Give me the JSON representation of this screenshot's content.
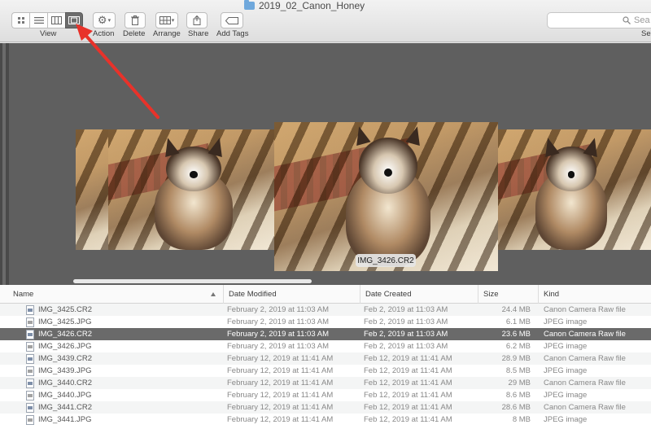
{
  "window": {
    "title": "2019_02_Canon_Honey",
    "folder_icon": "folder-icon"
  },
  "toolbar": {
    "view_label": "View",
    "action_label": "Action",
    "delete_label": "Delete",
    "arrange_label": "Arrange",
    "share_label": "Share",
    "add_tags_label": "Add Tags",
    "search_placeholder": "Sea",
    "search_label": "Se",
    "view_modes": [
      "icon-view",
      "list-view",
      "column-view",
      "gallery-view"
    ],
    "active_view": "gallery-view"
  },
  "gallery": {
    "selected_label": "IMG_3426.CR2",
    "annotation_color": "#e8322a"
  },
  "list": {
    "headers": {
      "name": "Name",
      "modified": "Date Modified",
      "created": "Date Created",
      "size": "Size",
      "kind": "Kind"
    },
    "rows": [
      {
        "name": "IMG_3425.CR2",
        "modified": "February 2, 2019 at 11:03 AM",
        "created": "Feb 2, 2019 at 11:03 AM",
        "size": "24.4 MB",
        "kind": "Canon Camera Raw file",
        "selected": false
      },
      {
        "name": "IMG_3425.JPG",
        "modified": "February 2, 2019 at 11:03 AM",
        "created": "Feb 2, 2019 at 11:03 AM",
        "size": "6.1 MB",
        "kind": "JPEG image",
        "selected": false
      },
      {
        "name": "IMG_3426.CR2",
        "modified": "February 2, 2019 at 11:03 AM",
        "created": "Feb 2, 2019 at 11:03 AM",
        "size": "23.6 MB",
        "kind": "Canon Camera Raw file",
        "selected": true
      },
      {
        "name": "IMG_3426.JPG",
        "modified": "February 2, 2019 at 11:03 AM",
        "created": "Feb 2, 2019 at 11:03 AM",
        "size": "6.2 MB",
        "kind": "JPEG image",
        "selected": false
      },
      {
        "name": "IMG_3439.CR2",
        "modified": "February 12, 2019 at 11:41 AM",
        "created": "Feb 12, 2019 at 11:41 AM",
        "size": "28.9 MB",
        "kind": "Canon Camera Raw file",
        "selected": false
      },
      {
        "name": "IMG_3439.JPG",
        "modified": "February 12, 2019 at 11:41 AM",
        "created": "Feb 12, 2019 at 11:41 AM",
        "size": "8.5 MB",
        "kind": "JPEG image",
        "selected": false
      },
      {
        "name": "IMG_3440.CR2",
        "modified": "February 12, 2019 at 11:41 AM",
        "created": "Feb 12, 2019 at 11:41 AM",
        "size": "29 MB",
        "kind": "Canon Camera Raw file",
        "selected": false
      },
      {
        "name": "IMG_3440.JPG",
        "modified": "February 12, 2019 at 11:41 AM",
        "created": "Feb 12, 2019 at 11:41 AM",
        "size": "8.6 MB",
        "kind": "JPEG image",
        "selected": false
      },
      {
        "name": "IMG_3441.CR2",
        "modified": "February 12, 2019 at 11:41 AM",
        "created": "Feb 12, 2019 at 11:41 AM",
        "size": "28.6 MB",
        "kind": "Canon Camera Raw file",
        "selected": false
      },
      {
        "name": "IMG_3441.JPG",
        "modified": "February 12, 2019 at 11:41 AM",
        "created": "Feb 12, 2019 at 11:41 AM",
        "size": "8 MB",
        "kind": "JPEG image",
        "selected": false
      }
    ]
  }
}
